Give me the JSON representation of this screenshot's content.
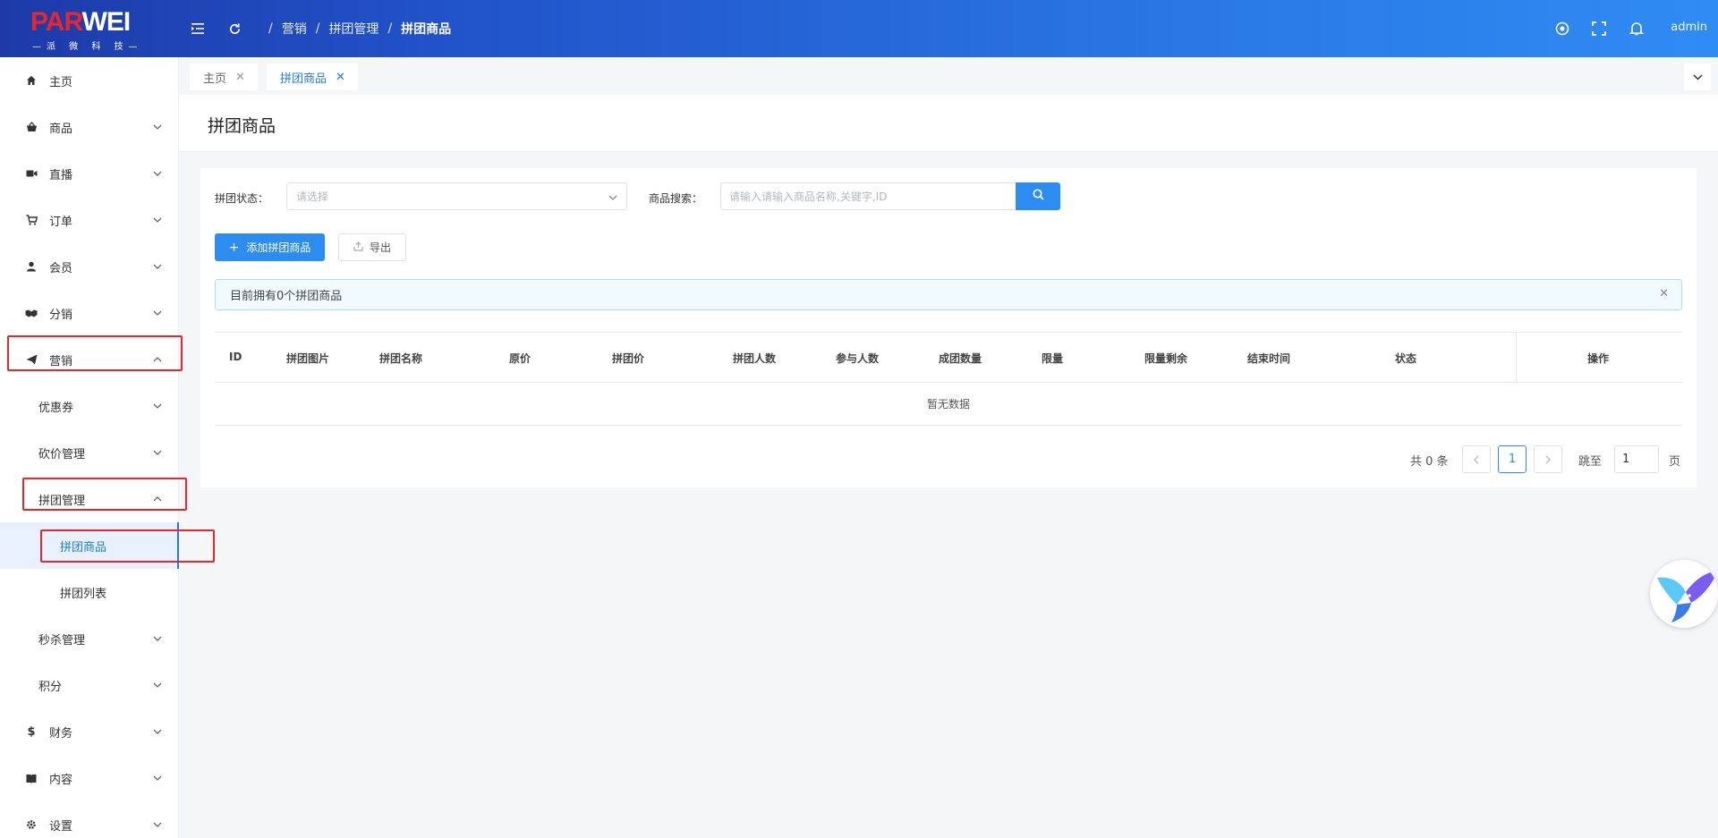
{
  "logo": {
    "brand_part1": "PAR",
    "brand_part2": "WEI",
    "subtitle": "—派 微 科 技—"
  },
  "header": {
    "breadcrumb": [
      "营销",
      "拼团管理",
      "拼团商品"
    ],
    "breadcrumb_sep": "/",
    "user": "admin",
    "icons": [
      "menu-fold-icon",
      "refresh-icon",
      "target-icon",
      "fullscreen-icon",
      "bell-icon"
    ]
  },
  "sidebar": {
    "items": [
      {
        "label": "主页",
        "icon": "home-icon"
      },
      {
        "label": "商品",
        "icon": "basket-icon"
      },
      {
        "label": "直播",
        "icon": "video-icon"
      },
      {
        "label": "订单",
        "icon": "cart-icon"
      },
      {
        "label": "会员",
        "icon": "user-icon"
      },
      {
        "label": "分销",
        "icon": "handshake-icon"
      },
      {
        "label": "营销",
        "icon": "paper-plane-icon"
      },
      {
        "label": "优惠券"
      },
      {
        "label": "砍价管理"
      },
      {
        "label": "拼团管理"
      },
      {
        "label": "拼团商品"
      },
      {
        "label": "拼团列表"
      },
      {
        "label": "秒杀管理"
      },
      {
        "label": "积分"
      },
      {
        "label": "财务",
        "icon": "dollar-icon"
      },
      {
        "label": "内容",
        "icon": "book-icon"
      },
      {
        "label": "设置",
        "icon": "gear-icon"
      }
    ]
  },
  "tabs": [
    {
      "label": "主页"
    },
    {
      "label": "拼团商品"
    }
  ],
  "page": {
    "title": "拼团商品"
  },
  "filters": {
    "status_label": "拼团状态：",
    "status_placeholder": "请选择",
    "search_label": "商品搜索：",
    "search_placeholder": "请输入请输入商品名称,关键字,ID"
  },
  "actions": {
    "add_label": "添加拼团商品",
    "export_label": "导出"
  },
  "alert": {
    "text": "目前拥有0个拼团商品"
  },
  "table": {
    "columns": [
      "ID",
      "拼团图片",
      "拼团名称",
      "原价",
      "拼团价",
      "拼团人数",
      "参与人数",
      "成团数量",
      "限量",
      "限量剩余",
      "结束时间",
      "状态",
      "操作"
    ],
    "empty_text": "暂无数据"
  },
  "pagination": {
    "total_text": "共 0 条",
    "current_page": "1",
    "goto_label": "跳至",
    "goto_value": "1",
    "page_suffix": "页"
  },
  "colors": {
    "primary": "#2d8cf0",
    "header_start": "#1d3aa8",
    "header_end": "#2f8cf2",
    "highlight_box": "#e8262b"
  }
}
